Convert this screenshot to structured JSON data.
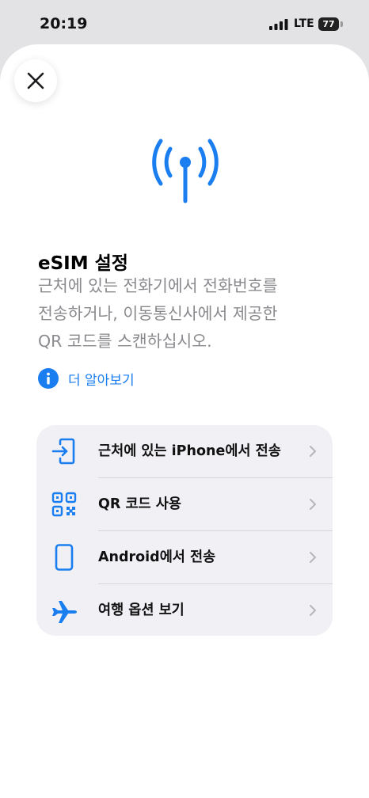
{
  "status_bar": {
    "time": "20:19",
    "network": "LTE",
    "battery": "77"
  },
  "sheet": {
    "close_icon": "close-icon",
    "hero_icon": "antenna-signal-icon",
    "title": "eSIM 설정",
    "description_lines": [
      "근처에 있는 전화기에서 전화번호를",
      "전송하거나, 이동통신사에서 제공한",
      "QR 코드를 스캔하십시오."
    ],
    "learn_more": "더 알아보기",
    "accent_color": "#1a7df0"
  },
  "options": [
    {
      "label": "근처에 있는 iPhone에서 전송",
      "icon": "transfer-in-icon"
    },
    {
      "label": "QR 코드 사용",
      "icon": "qr-code-icon"
    },
    {
      "label": "Android에서 전송",
      "icon": "phone-icon"
    },
    {
      "label": "여행 옵션 보기",
      "icon": "airplane-icon"
    }
  ]
}
